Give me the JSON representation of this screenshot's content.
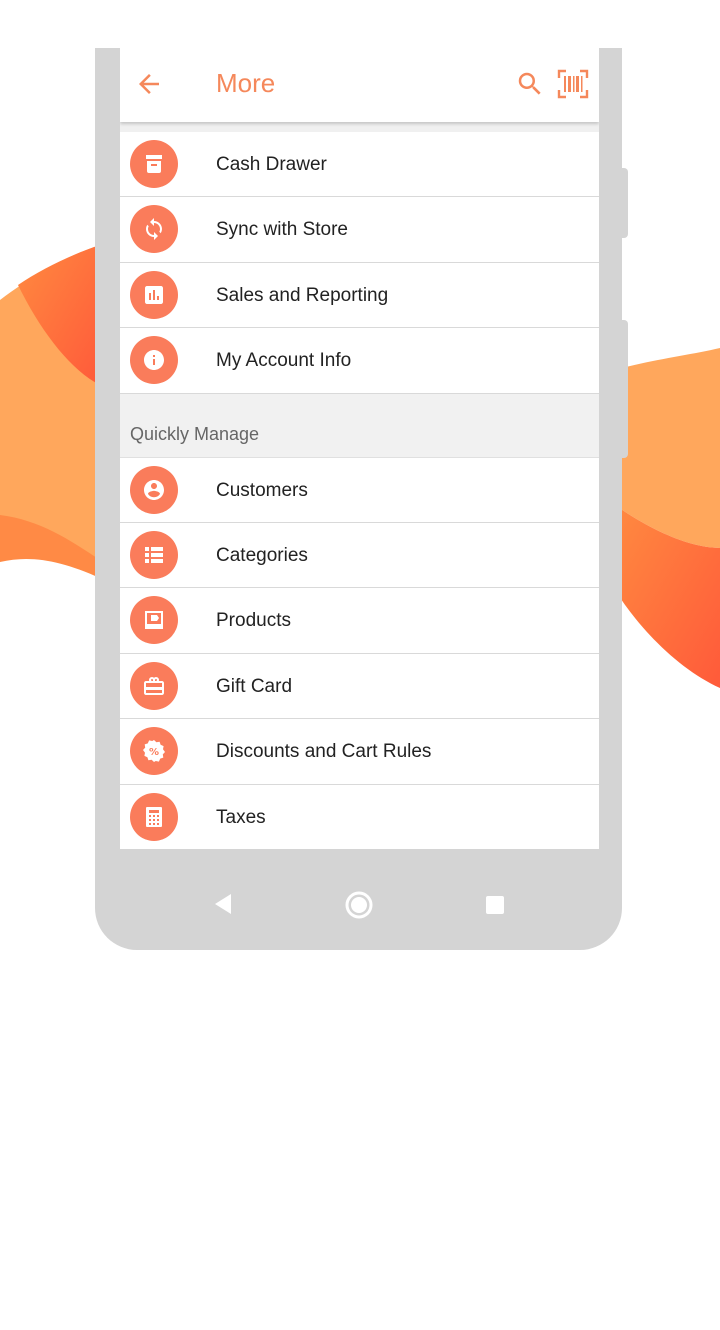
{
  "colors": {
    "accent": "#f5885b",
    "icon_circle": "#fa7c5b",
    "wave_light": "#ffa45c",
    "wave_dark": "#ff6a3a"
  },
  "appbar": {
    "title": "More",
    "back_icon": "arrow-left-icon",
    "search_icon": "search-icon",
    "barcode_icon": "barcode-scan-icon"
  },
  "menu_items": [
    {
      "label": "Cash Drawer",
      "icon": "cash-drawer-icon"
    },
    {
      "label": "Sync with Store",
      "icon": "sync-icon"
    },
    {
      "label": "Sales and Reporting",
      "icon": "bar-chart-icon"
    },
    {
      "label": "My Account Info",
      "icon": "info-icon"
    }
  ],
  "section": {
    "title": "Quickly Manage",
    "items": [
      {
        "label": "Customers",
        "icon": "account-circle-icon"
      },
      {
        "label": "Categories",
        "icon": "list-icon"
      },
      {
        "label": "Products",
        "icon": "product-tag-icon"
      },
      {
        "label": "Gift Card",
        "icon": "gift-card-icon"
      },
      {
        "label": "Discounts and Cart Rules",
        "icon": "discount-percent-icon"
      },
      {
        "label": "Taxes",
        "icon": "calculator-icon"
      }
    ]
  },
  "nav": {
    "back_icon": "nav-back-icon",
    "home_icon": "nav-home-icon",
    "recent_icon": "nav-recent-apps-icon"
  }
}
